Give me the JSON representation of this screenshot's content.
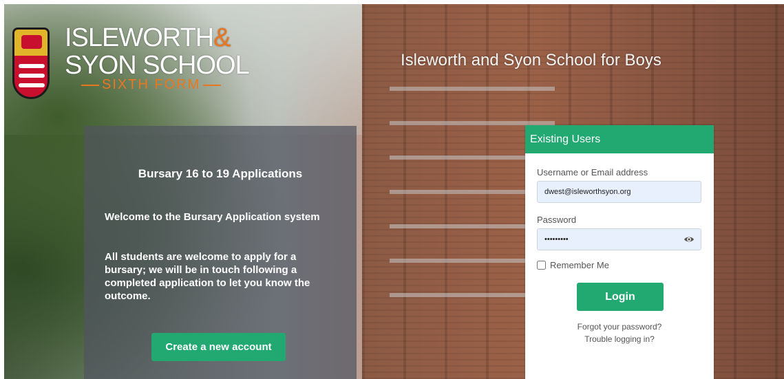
{
  "brand": {
    "line1_part": "ISLEWORTH",
    "ampersand": "&",
    "line2": "SYON SCHOOL",
    "subline": "SIXTH FORM",
    "accent_color": "#e87722"
  },
  "tagline": "Isleworth and Syon School for Boys",
  "info_panel": {
    "title": "Bursary 16 to 19 Applications",
    "welcome": "Welcome to the Bursary Application system",
    "body": "All students are welcome to apply for a bursary; we will be in touch following a completed application to let you know the outcome.",
    "create_button": "Create a new account"
  },
  "login": {
    "header": "Existing Users",
    "username_label": "Username or Email address",
    "username_value": "dwest@isleworthsyon.org",
    "password_label": "Password",
    "password_value": "•••••••••",
    "password_icon": "eye-icon",
    "remember_label": "Remember Me",
    "remember_checked": false,
    "login_button": "Login",
    "forgot_link": "Forgot your password?",
    "trouble_link": "Trouble logging in?"
  },
  "colors": {
    "primary_green": "#22a871",
    "panel_overlay": "rgba(80,85,95,0.72)"
  }
}
